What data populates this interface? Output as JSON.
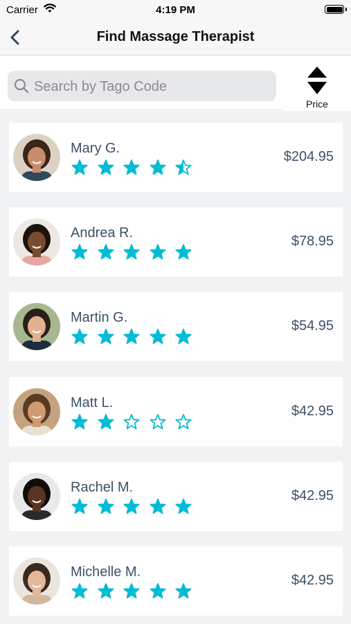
{
  "status_bar": {
    "carrier": "Carrier",
    "time": "4:19 PM"
  },
  "nav": {
    "title": "Find Massage Therapist"
  },
  "search": {
    "placeholder": "Search by Tago Code",
    "value": ""
  },
  "sort": {
    "label": "Price"
  },
  "accent_color": "#00bcd4",
  "therapists": [
    {
      "name": "Mary G.",
      "rating": 4.5,
      "price": "$204.95",
      "skin": "#c88d6c",
      "hair": "#3b2418",
      "shirt": "#2e4a5a",
      "bg": "#dcd2c4"
    },
    {
      "name": "Andrea R.",
      "rating": 5,
      "price": "$78.95",
      "skin": "#7a4b2e",
      "hair": "#1b120c",
      "shirt": "#e7a6a0",
      "bg": "#ece8e2"
    },
    {
      "name": "Martin G.",
      "rating": 5,
      "price": "$54.95",
      "skin": "#e0b08f",
      "hair": "#2a1f18",
      "shirt": "#1f2d3f",
      "bg": "#a7b78f"
    },
    {
      "name": "Matt L.",
      "rating": 2,
      "price": "$42.95",
      "skin": "#d19a72",
      "hair": "#5b3a22",
      "shirt": "#e8e2d6",
      "bg": "#c4a27d"
    },
    {
      "name": "Rachel M.",
      "rating": 5,
      "price": "$42.95",
      "skin": "#5c3422",
      "hair": "#120c0a",
      "shirt": "#2a2a2a",
      "bg": "#e9e9e9"
    },
    {
      "name": "Michelle M.",
      "rating": 5,
      "price": "$42.95",
      "skin": "#e5b89a",
      "hair": "#3a2a20",
      "shirt": "#d2b79e",
      "bg": "#ebe5df"
    }
  ]
}
